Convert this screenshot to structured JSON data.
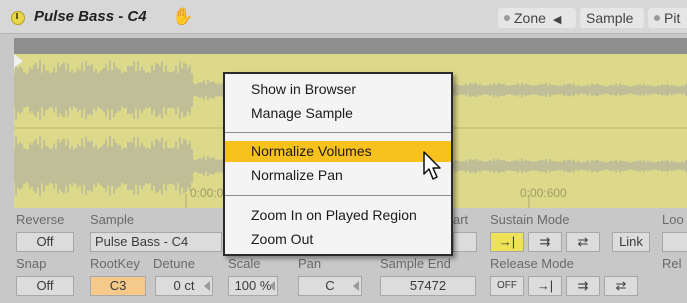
{
  "titlebar": {
    "title": "Pulse Bass - C4",
    "icons": {
      "power": "power-icon",
      "hand": "hand-icon"
    },
    "tabs": [
      {
        "label": "Zone",
        "suffix": "◀"
      },
      {
        "label": "Sample"
      },
      {
        "label": "Pit"
      }
    ]
  },
  "display": {
    "ruler": {
      "left": "0:00:000",
      "right": "0:00:600"
    }
  },
  "controls": {
    "reverse": {
      "label": "Reverse",
      "value": "Off"
    },
    "sample": {
      "label": "Sample",
      "value": "Pulse Bass - C4"
    },
    "start": {
      "label": "art"
    },
    "sustain_mode": {
      "label": "Sustain Mode",
      "buttons": [
        "→|",
        "⇉",
        "⇄"
      ],
      "link": "Link"
    },
    "loop": {
      "label": "Loo"
    },
    "snap": {
      "label": "Snap",
      "value": "Off"
    },
    "rootkey": {
      "label": "RootKey",
      "value": "C3"
    },
    "detune": {
      "label": "Detune",
      "value": "0 ct"
    },
    "scale": {
      "label": "Scale",
      "value": "100 %"
    },
    "pan": {
      "label": "Pan",
      "value": "C"
    },
    "sample_end": {
      "label": "Sample End",
      "value": "57472"
    },
    "release_mode": {
      "label": "Release Mode",
      "off": "OFF",
      "buttons": [
        "→|",
        "⇉",
        "⇄"
      ]
    },
    "release": {
      "label": "Rel"
    }
  },
  "context_menu": {
    "items": [
      {
        "label": "Show in Browser"
      },
      {
        "label": "Manage Sample"
      },
      {
        "label": "Normalize Volumes",
        "highlighted": true
      },
      {
        "label": "Normalize Pan"
      },
      {
        "label": "Zoom In on Played Region"
      },
      {
        "label": "Zoom Out"
      }
    ]
  },
  "colors": {
    "waveform_bg": "#ddd98a",
    "waveform": "#9a9a9a",
    "highlight": "#f7c21e",
    "rootkey": "#f4c98a",
    "sustain_active": "#ede258"
  }
}
